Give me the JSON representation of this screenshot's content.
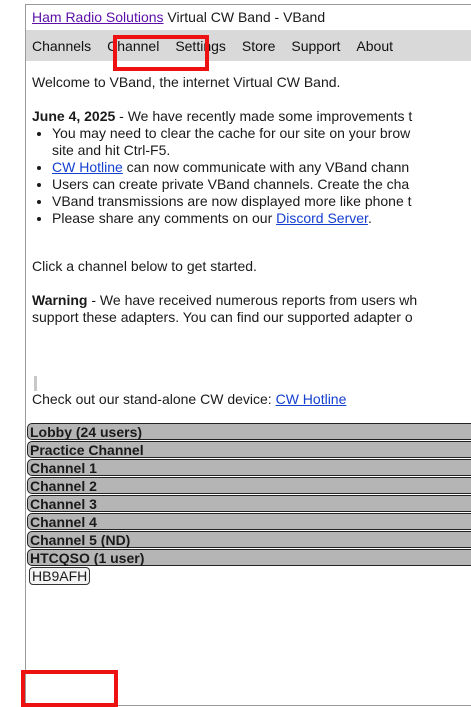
{
  "window": {
    "title_link": "Ham Radio Solutions",
    "title_rest": "Virtual CW Band - VBand"
  },
  "nav": [
    "Channels",
    "Channel",
    "Settings",
    "Store",
    "Support",
    "About"
  ],
  "welcome": "Welcome to VBand, the internet Virtual CW Band.",
  "update": {
    "date": "June 4, 2025",
    "text": " - We have recently made some improvements t",
    "items": [
      {
        "pre": "You may need to clear the cache for our site on your brow",
        "line2": "site and hit Ctrl-F5."
      },
      {
        "link": "CW Hotline",
        "post": " can now communicate with any VBand chann"
      },
      {
        "pre": "Users can create private VBand channels. Create the cha"
      },
      {
        "pre": "VBand transmissions are now displayed more like phone t"
      },
      {
        "pre": "Please share any comments on our ",
        "link": "Discord Server",
        "post": "."
      }
    ]
  },
  "click_prompt": "Click a channel below to get started.",
  "warning": {
    "label": "Warning",
    "line1": " - We have received numerous reports from users wh",
    "line2": "support these adapters. You can find our supported adapter o"
  },
  "standalone": {
    "text": "Check out our stand-alone CW device: ",
    "link": "CW Hotline"
  },
  "channels": [
    "Lobby (24 users)",
    "Practice Channel",
    "Channel 1",
    "Channel 2",
    "Channel 3",
    "Channel 4",
    "Channel 5 (ND)",
    "HTCQSO (1 user)"
  ],
  "users": [
    "HB9AFH"
  ],
  "highlight_color": "#ee1111"
}
